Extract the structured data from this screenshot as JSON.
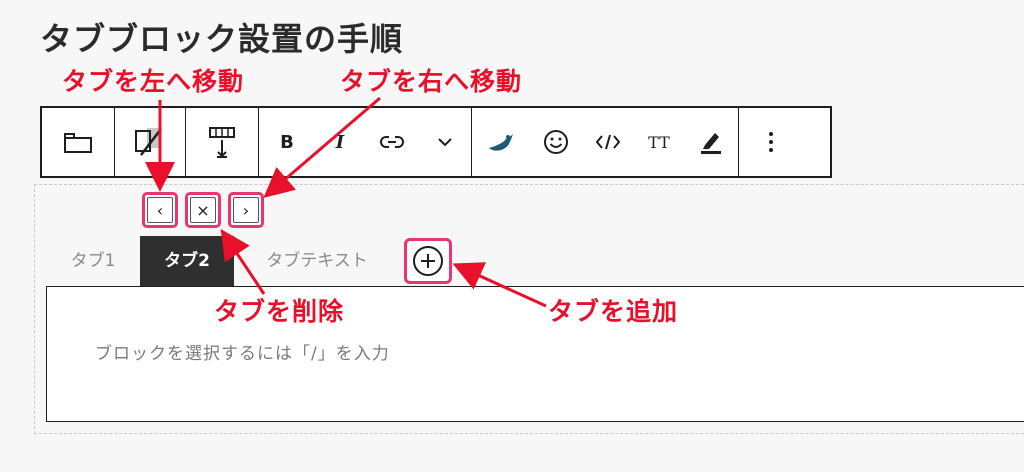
{
  "page": {
    "title": "タブブロック設置の手順"
  },
  "toolbar": {
    "bold_label": "B",
    "italic_label": "I",
    "text_size_label": "TT"
  },
  "tab_tools": {
    "move_left_glyph": "‹",
    "delete_glyph": "×",
    "move_right_glyph": "›"
  },
  "tabs": [
    {
      "label": "タブ1",
      "active": false
    },
    {
      "label": "タブ2",
      "active": true
    },
    {
      "label": "タブテキスト",
      "active": false
    }
  ],
  "panel": {
    "placeholder": "ブロックを選択するには「/」を入力"
  },
  "annotations": {
    "move_left": "タブを左へ移動",
    "move_right": "タブを右へ移動",
    "delete": "タブを削除",
    "add": "タブを追加"
  },
  "colors": {
    "annotation": "#e8102a",
    "highlight_border": "#e8376f",
    "active_tab": "#2f2f2f"
  }
}
